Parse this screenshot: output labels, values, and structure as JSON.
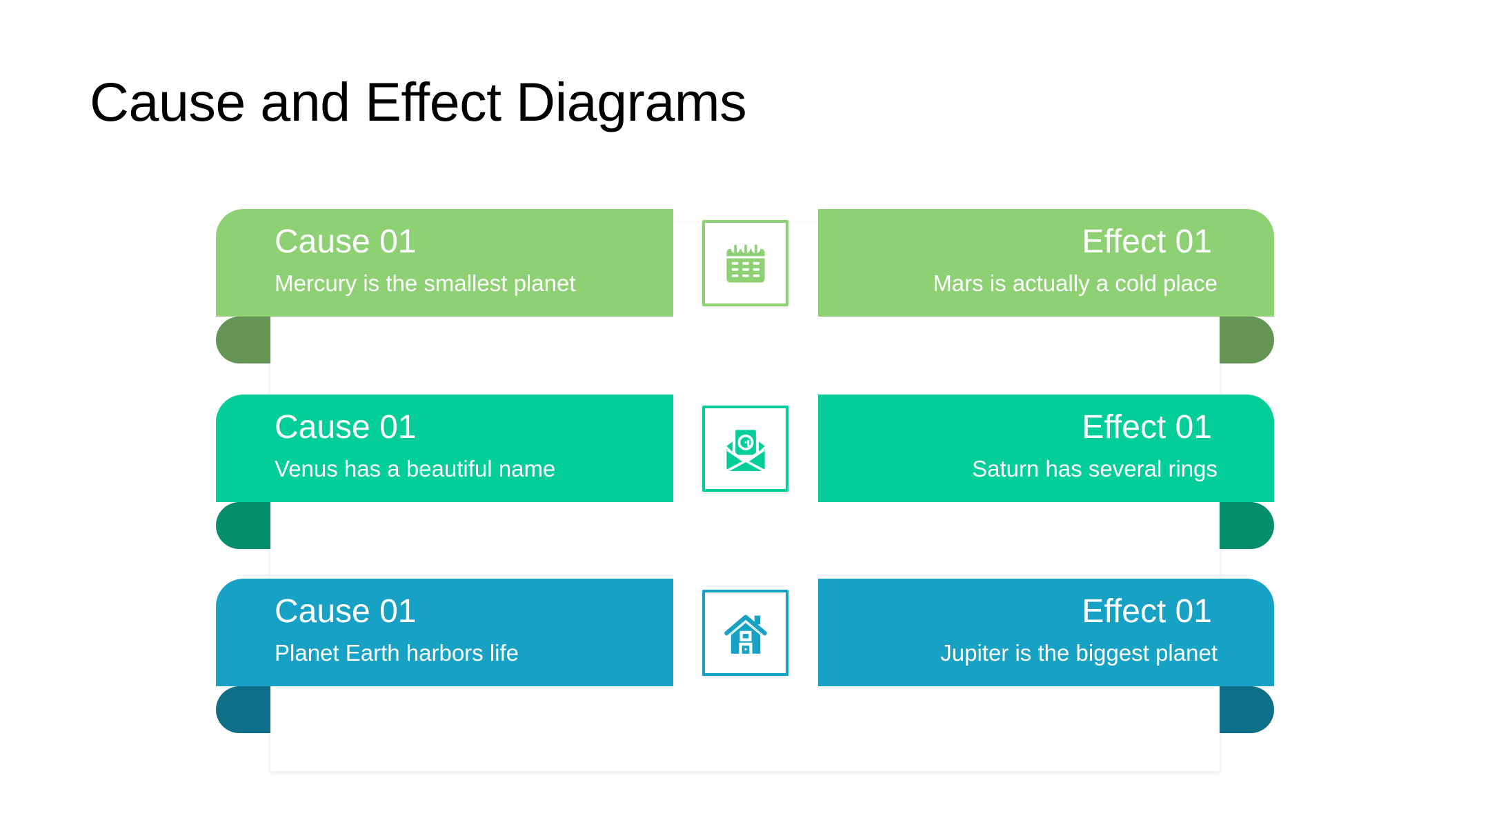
{
  "slide": {
    "title": "Cause and Effect Diagrams"
  },
  "rows": [
    {
      "cause": {
        "title": "Cause 01",
        "text": "Mercury is the smallest planet"
      },
      "effect": {
        "title": "Effect 01",
        "text": "Mars is actually a cold place"
      },
      "icon": "calendar-icon",
      "colors": {
        "main": "#8ED174",
        "dark": "#659554"
      }
    },
    {
      "cause": {
        "title": "Cause 01",
        "text": "Venus has a beautiful name"
      },
      "effect": {
        "title": "Effect 01",
        "text": "Saturn has several rings"
      },
      "icon": "email-icon",
      "colors": {
        "main": "#03CD98",
        "dark": "#048E6C"
      }
    },
    {
      "cause": {
        "title": "Cause 01",
        "text": "Planet Earth harbors life"
      },
      "effect": {
        "title": "Effect 01",
        "text": "Jupiter is the biggest planet"
      },
      "icon": "house-icon",
      "colors": {
        "main": "#17A1C5",
        "dark": "#0F6F89"
      }
    }
  ]
}
